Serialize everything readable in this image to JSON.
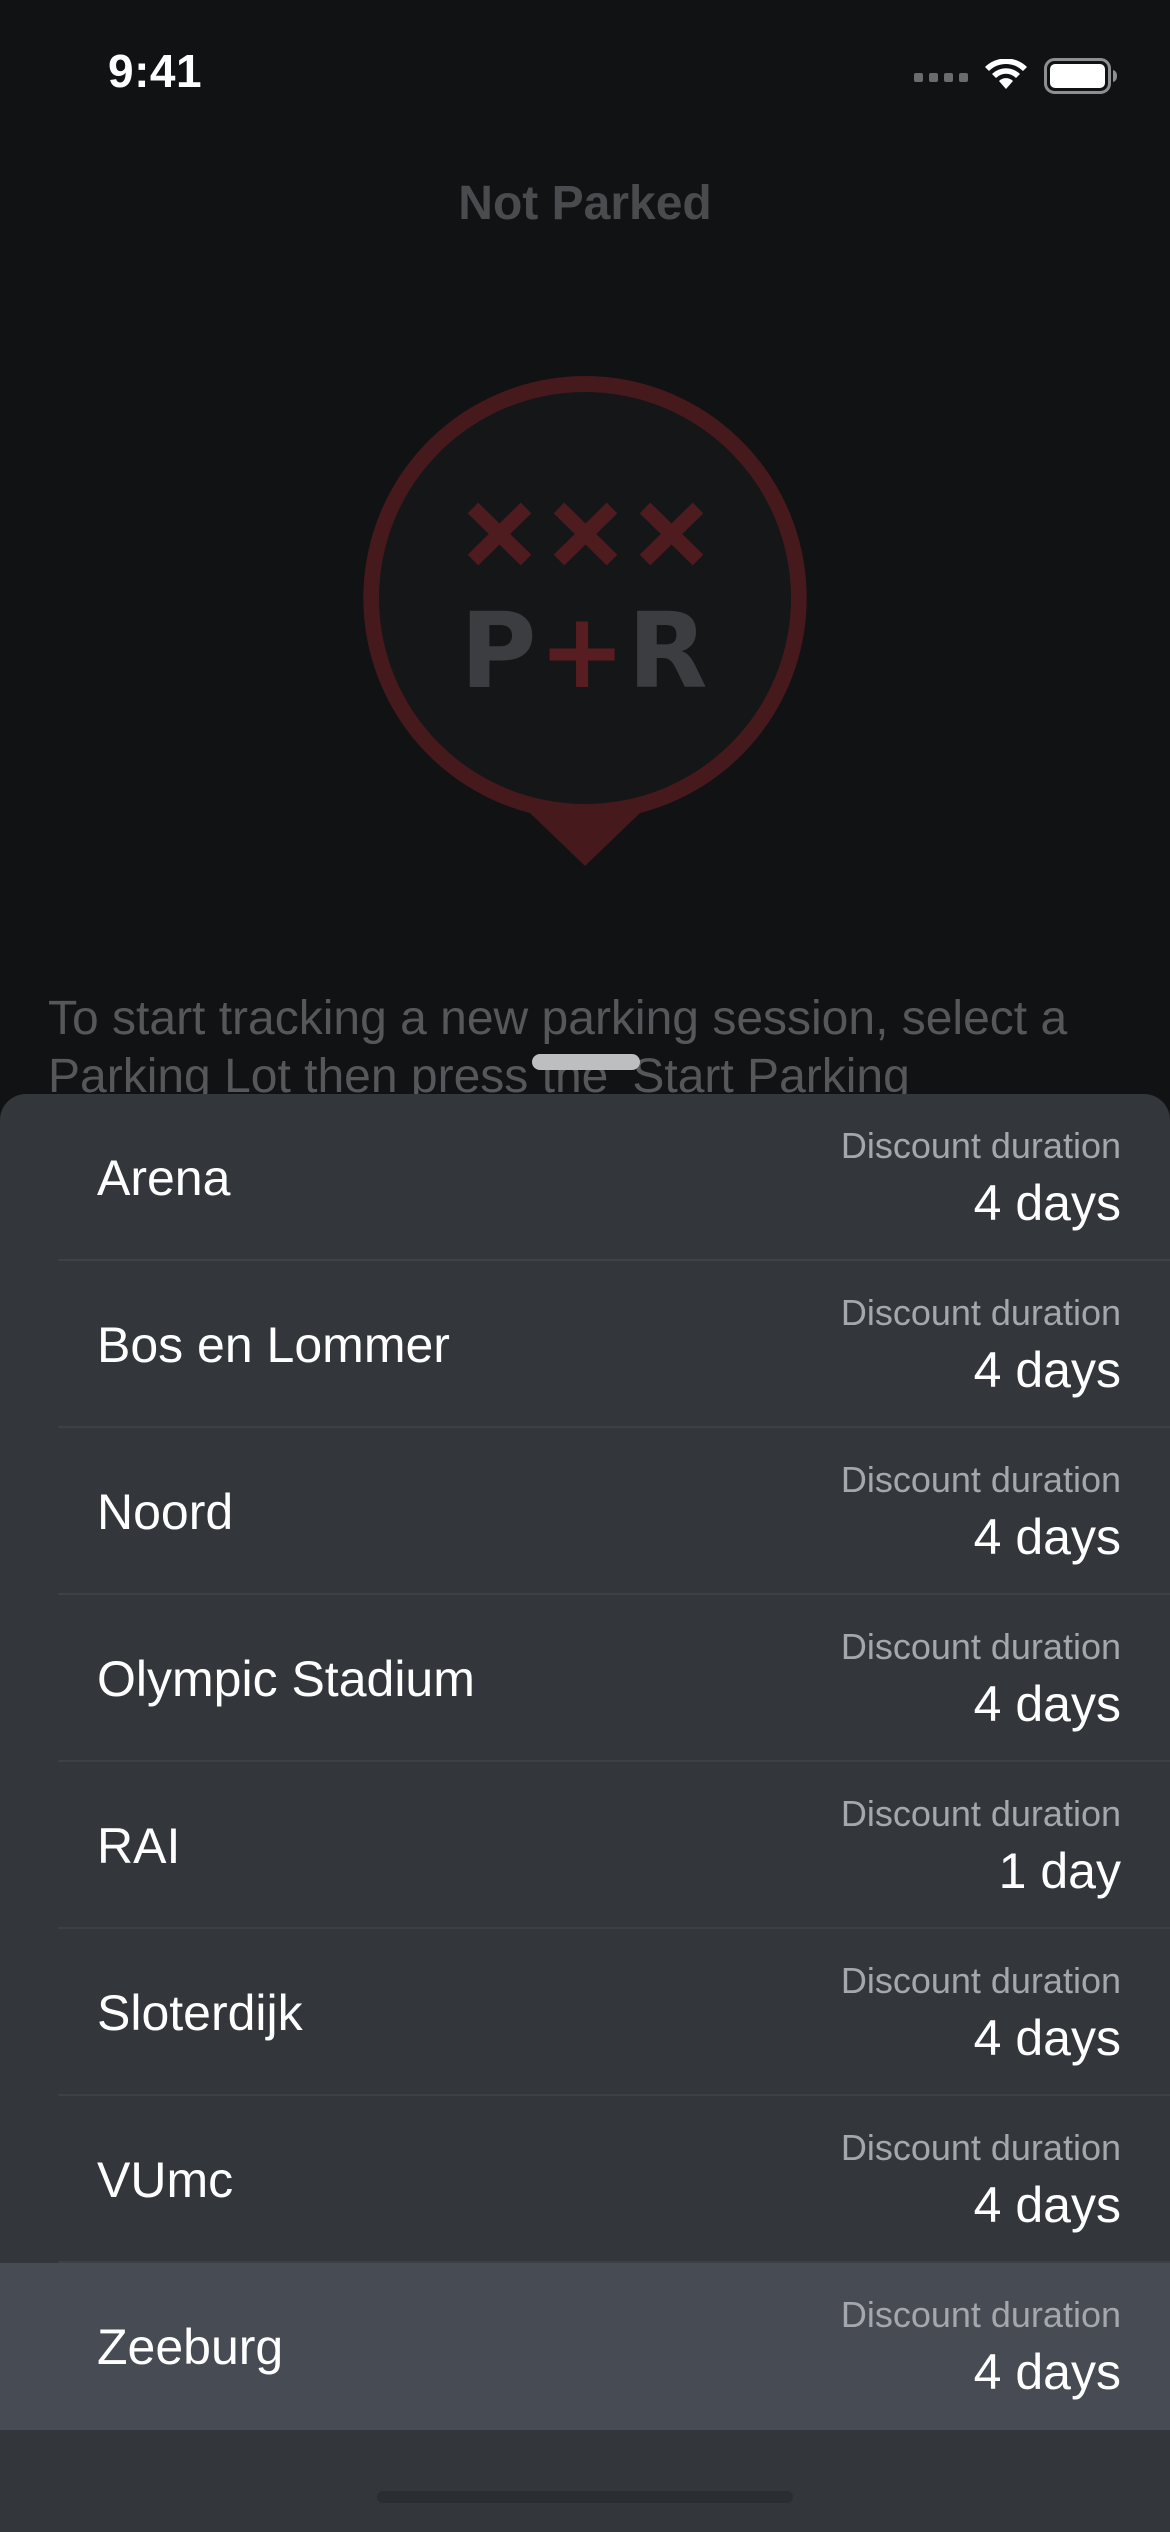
{
  "status_bar": {
    "time": "9:41",
    "icons": [
      "cellular-signal-icon",
      "wifi-icon",
      "battery-icon"
    ]
  },
  "header": {
    "title": "Not Parked"
  },
  "logo": {
    "name": "P+R logo",
    "symbol": "XXX",
    "text_p": "P",
    "text_plus": "+",
    "text_r": "R",
    "colors": {
      "ring": "#4a1c1f",
      "text": "#3f4043",
      "plus": "#5a1e21"
    }
  },
  "intro": {
    "text": "To start tracking a new parking session, select a Parking Lot then press the ‘Start Parking"
  },
  "sheet": {
    "lots": [
      {
        "name": "Arena",
        "label": "Discount duration",
        "value": "4 days",
        "selected": false
      },
      {
        "name": "Bos en Lommer",
        "label": "Discount duration",
        "value": "4 days",
        "selected": false
      },
      {
        "name": "Noord",
        "label": "Discount duration",
        "value": "4 days",
        "selected": false
      },
      {
        "name": "Olympic Stadium",
        "label": "Discount duration",
        "value": "4 days",
        "selected": false
      },
      {
        "name": "RAI",
        "label": "Discount duration",
        "value": "1 day",
        "selected": false
      },
      {
        "name": "Sloterdijk",
        "label": "Discount duration",
        "value": "4 days",
        "selected": false
      },
      {
        "name": "VUmc",
        "label": "Discount duration",
        "value": "4 days",
        "selected": false
      },
      {
        "name": "Zeeburg",
        "label": "Discount duration",
        "value": "4 days",
        "selected": true
      }
    ]
  },
  "colors": {
    "background": "#111214",
    "sheet": "#33373c",
    "selected_row": "#474b53",
    "secondary_text": "#a4a7ab"
  }
}
